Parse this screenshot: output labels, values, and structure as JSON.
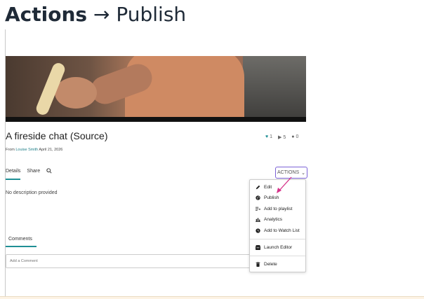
{
  "heading": {
    "bold": "Actions",
    "rest": "→ Publish"
  },
  "media": {
    "title": "A fireside chat (Source)",
    "byline_prefix": "From",
    "author": "Louise Smith",
    "date": "April 21, 2026",
    "stats": {
      "likes": "1",
      "plays": "5",
      "comments": "0"
    }
  },
  "tabs": [
    "Details",
    "Share"
  ],
  "actions_button": "ACTIONS",
  "description": "No description provided",
  "comments": {
    "tab": "Comments",
    "placeholder": "Add a Comment"
  },
  "menu": {
    "items": [
      "Edit",
      "Publish",
      "Add to playlist",
      "Analytics",
      "Add to Watch List"
    ],
    "editor": "Launch Editor",
    "delete": "Delete"
  },
  "colors": {
    "accent": "#1f8f95",
    "arrow": "#d6338a",
    "focus": "#7b61d6"
  }
}
